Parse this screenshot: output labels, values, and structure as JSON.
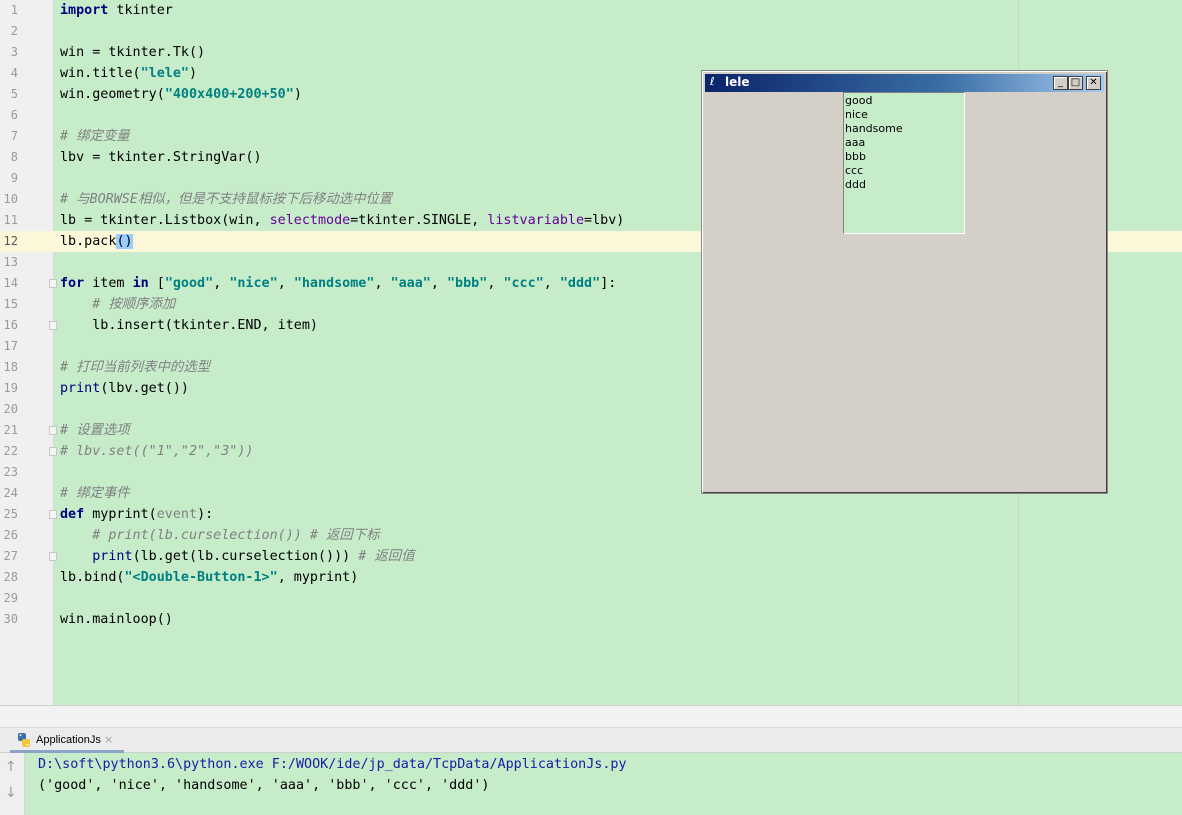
{
  "editor": {
    "current_line": 12,
    "lines": [
      {
        "n": "1",
        "html": "<span class='kw'>import</span> tkinter"
      },
      {
        "n": "2",
        "html": ""
      },
      {
        "n": "3",
        "html": "win = tkinter.Tk()"
      },
      {
        "n": "4",
        "html": "win.title(<span class='str'>\"lele\"</span>)"
      },
      {
        "n": "5",
        "html": "win.geometry(<span class='str'>\"400x400+200+50\"</span>)"
      },
      {
        "n": "6",
        "html": ""
      },
      {
        "n": "7",
        "html": "<span class='cmt'># 绑定变量</span>"
      },
      {
        "n": "8",
        "html": "lbv = tkinter.StringVar()"
      },
      {
        "n": "9",
        "html": ""
      },
      {
        "n": "10",
        "html": "<span class='cmt'># 与BORWSE相似，但是不支持鼠标按下后移动选中位置</span>"
      },
      {
        "n": "11",
        "html": "lb = tkinter.Listbox(win, <span class='kwarg'>selectmode</span>=tkinter.SINGLE, <span class='kwarg'>listvariable</span>=lbv)"
      },
      {
        "n": "12",
        "html": "lb.pack<span class='caret-hl'>()</span>"
      },
      {
        "n": "13",
        "html": ""
      },
      {
        "n": "14",
        "html": "<span class='kw'>for</span> item <span class='kw'>in</span> [<span class='str'>\"good\"</span>, <span class='str'>\"nice\"</span>, <span class='str'>\"handsome\"</span>, <span class='str'>\"aaa\"</span>, <span class='str'>\"bbb\"</span>, <span class='str'>\"ccc\"</span>, <span class='str'>\"ddd\"</span>]:"
      },
      {
        "n": "15",
        "html": "    <span class='cmt'># 按顺序添加</span>"
      },
      {
        "n": "16",
        "html": "    lb.insert(tkinter.END, item)"
      },
      {
        "n": "17",
        "html": ""
      },
      {
        "n": "18",
        "html": "<span class='cmt'># 打印当前列表中的选型</span>"
      },
      {
        "n": "19",
        "html": "<span class='bi'>print</span>(lbv.get())"
      },
      {
        "n": "20",
        "html": ""
      },
      {
        "n": "21",
        "html": "<span class='cmt'># 设置选项</span>"
      },
      {
        "n": "22",
        "html": "<span class='cmt'># lbv.set((\"1\",\"2\",\"3\"))</span>"
      },
      {
        "n": "23",
        "html": ""
      },
      {
        "n": "24",
        "html": "<span class='cmt'># 绑定事件</span>"
      },
      {
        "n": "25",
        "html": "<span class='kw'>def</span> myprint(<span class='param'>event</span>):"
      },
      {
        "n": "26",
        "html": "    <span class='cmt'># print(lb.curselection()) # 返回下标</span>"
      },
      {
        "n": "27",
        "html": "    <span class='bi'>print</span>(lb.get(lb.curselection())) <span class='cmt'># 返回值</span>"
      },
      {
        "n": "28",
        "html": "lb.bind(<span class='str'>\"&lt;Double-Button-1&gt;\"</span>, myprint)"
      },
      {
        "n": "29",
        "html": ""
      },
      {
        "n": "30",
        "html": "win.mainloop()"
      }
    ]
  },
  "tk_window": {
    "title": "lele",
    "title_icon": "feather-icon",
    "minimize": "_",
    "maximize": "□",
    "close": "✕",
    "listbox_items": [
      "good",
      "nice",
      "handsome",
      "aaa",
      "bbb",
      "ccc",
      "ddd"
    ]
  },
  "run_panel": {
    "tab_label": "ApplicationJs",
    "tab_close": "×",
    "up_arrow": "↑",
    "down_arrow": "↓",
    "command": "D:\\soft\\python3.6\\python.exe F:/WOOK/ide/jp_data/TcpData/ApplicationJs.py",
    "output": "('good', 'nice', 'handsome', 'aaa', 'bbb', 'ccc', 'ddd')"
  },
  "colors": {
    "editor_bg": "#c7ecca",
    "keyword": "#000080",
    "string": "#008080",
    "comment": "#808080",
    "kwarg": "#660099",
    "current_line": "#fbf8d9"
  }
}
